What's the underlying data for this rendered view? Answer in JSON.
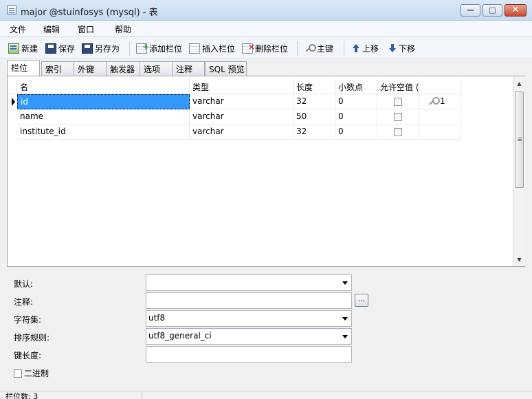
{
  "window": {
    "title": "major @stuinfosys (mysql) - 表",
    "minimize": "—",
    "maximize": "□",
    "close": "✕"
  },
  "menu": [
    "文件",
    "编辑",
    "窗口",
    "帮助"
  ],
  "toolbar": {
    "new": "新建",
    "save": "保存",
    "save_as": "另存为",
    "add_field": "添加栏位",
    "insert_field": "插入栏位",
    "delete_field": "删除栏位",
    "primary_key": "主键",
    "move_up": "上移",
    "move_down": "下移"
  },
  "tabs": [
    "栏位",
    "索引",
    "外键",
    "触发器",
    "选项",
    "注释",
    "SQL 预览"
  ],
  "grid": {
    "columns": [
      "名",
      "类型",
      "长度",
      "小数点",
      "允许空值 ("
    ],
    "rows": [
      {
        "name": "id",
        "type": "varchar",
        "length": "32",
        "decimals": "0",
        "pk": "1"
      },
      {
        "name": "name",
        "type": "varchar",
        "length": "50",
        "decimals": "0",
        "pk": ""
      },
      {
        "name": "institute_id",
        "type": "varchar",
        "length": "32",
        "decimals": "0",
        "pk": ""
      }
    ]
  },
  "props": {
    "default_label": "默认:",
    "default_value": "",
    "comment_label": "注释:",
    "comment_value": "",
    "comment_btn": "...",
    "charset_label": "字符集:",
    "charset_value": "utf8",
    "collation_label": "排序规则:",
    "collation_value": "utf8_general_ci",
    "keylen_label": "键长度:",
    "keylen_value": "",
    "binary_label": "二进制"
  },
  "status": {
    "text": "栏位数: 3"
  }
}
